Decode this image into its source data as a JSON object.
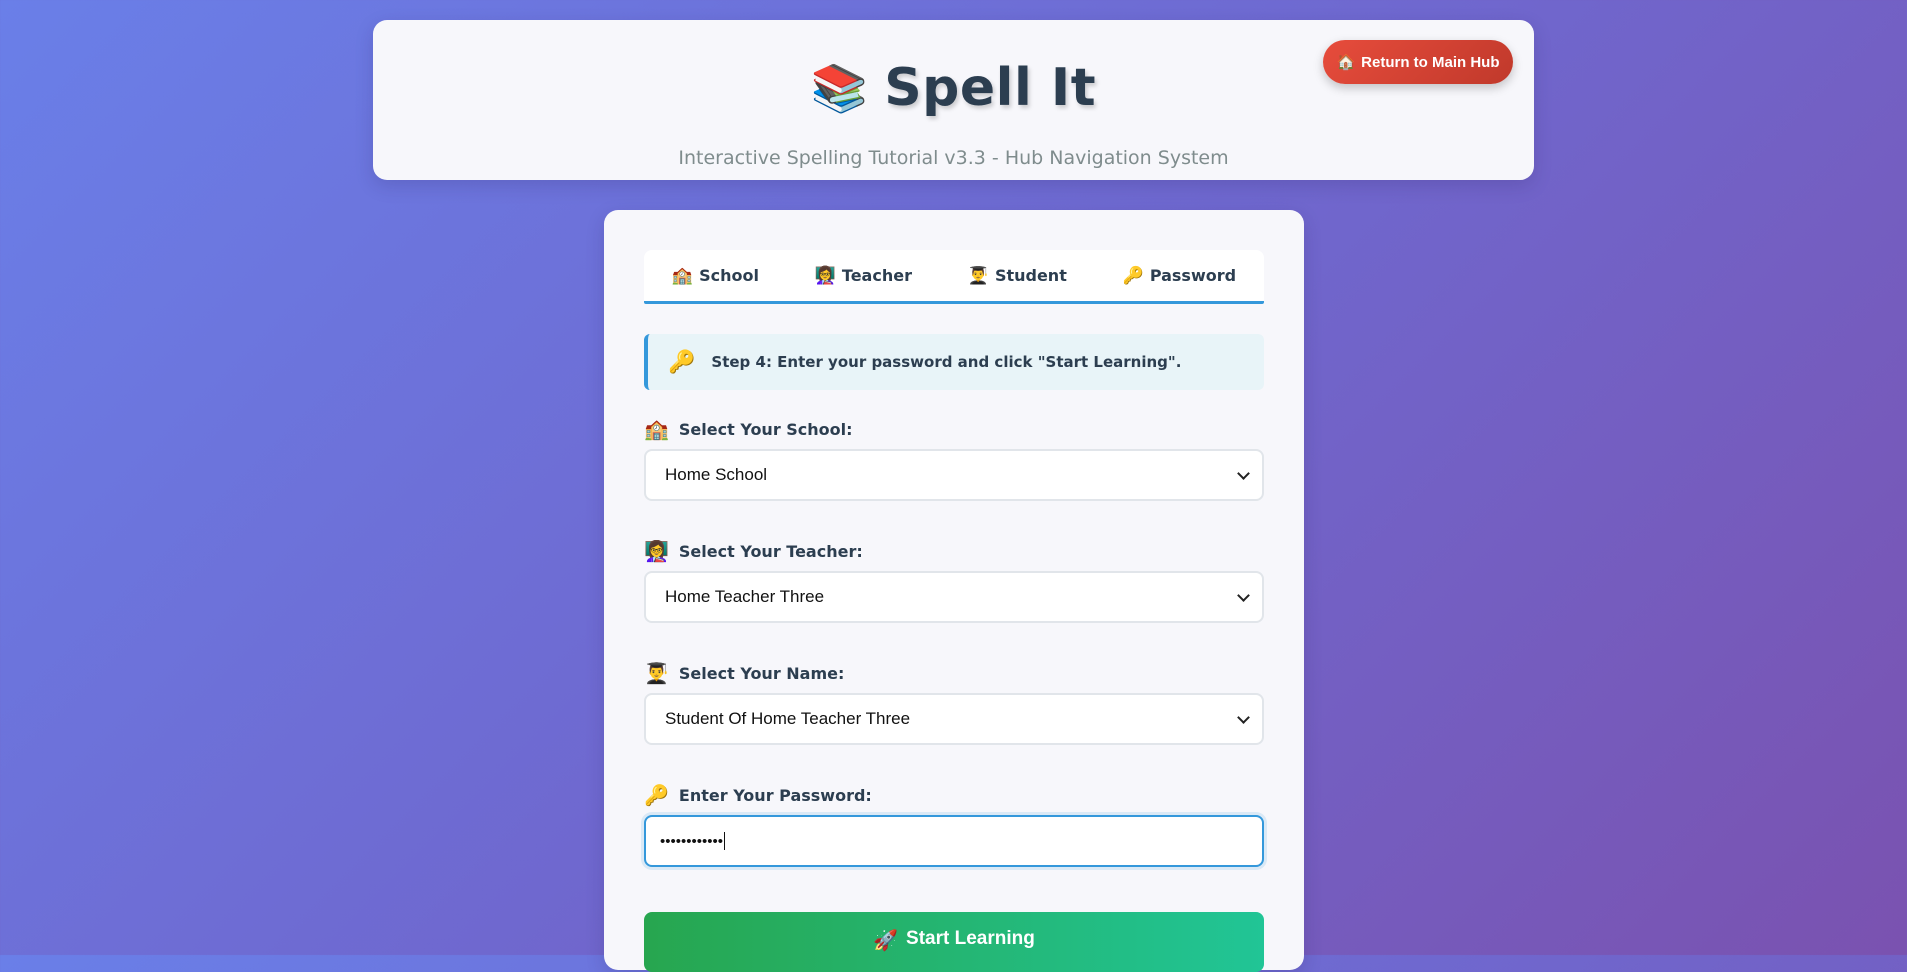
{
  "header": {
    "logo_emoji": "📚",
    "title": "Spell It",
    "subtitle": "Interactive Spelling Tutorial v3.3 - Hub Navigation System",
    "hub_button": {
      "icon": "🏠",
      "label": "Return to Main Hub"
    }
  },
  "steps": [
    {
      "icon": "🏫",
      "label": "School"
    },
    {
      "icon": "👩‍🏫",
      "label": "Teacher"
    },
    {
      "icon": "👨‍🎓",
      "label": "Student"
    },
    {
      "icon": "🔑",
      "label": "Password"
    }
  ],
  "notice": {
    "icon": "🔑",
    "text": "Step 4: Enter your password and click \"Start Learning\"."
  },
  "form": {
    "school": {
      "icon": "🏫",
      "label": "Select Your School:",
      "value": "Home School"
    },
    "teacher": {
      "icon": "👩‍🏫",
      "label": "Select Your Teacher:",
      "value": "Home Teacher Three"
    },
    "student": {
      "icon": "👨‍🎓",
      "label": "Select Your Name:",
      "value": "Student Of Home Teacher Three"
    },
    "password": {
      "icon": "🔑",
      "label": "Enter Your Password:",
      "masked_value": "••••••••••••"
    }
  },
  "start_button": {
    "icon": "🚀",
    "label": "Start Learning"
  },
  "colors": {
    "accent": "#3498db",
    "hub_button": "#e74c3c",
    "start_button_from": "#27a64f",
    "start_button_to": "#21c596",
    "title": "#2c3e50"
  }
}
